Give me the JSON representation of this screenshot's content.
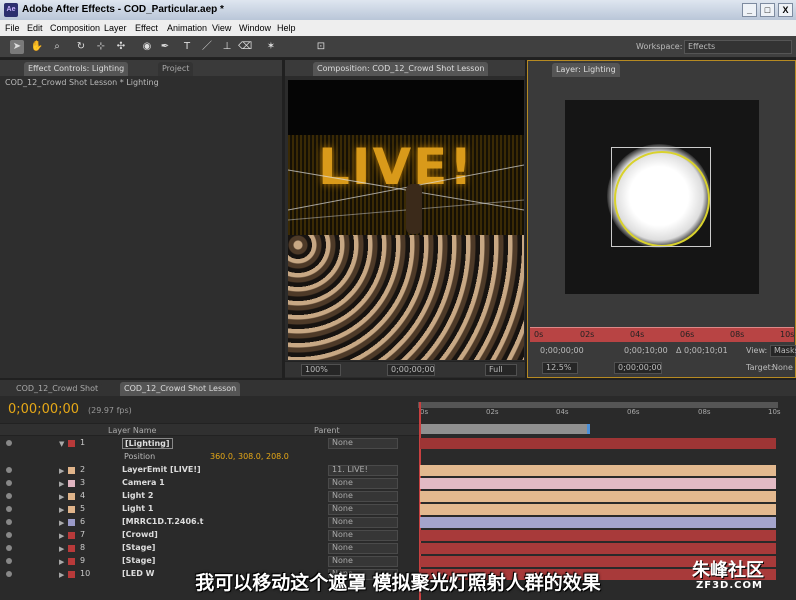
{
  "window": {
    "title": "Adobe After Effects - COD_Particular.aep *",
    "logo": "Ae",
    "min": "_",
    "max": "□",
    "close": "X"
  },
  "menu": [
    "File",
    "Edit",
    "Composition",
    "Layer",
    "Effect",
    "Animation",
    "View",
    "Window",
    "Help"
  ],
  "workspace": {
    "label": "Workspace:",
    "value": "Effects"
  },
  "left_panel": {
    "tabs": [
      "Effect Controls: Lighting",
      "Project"
    ],
    "path": "COD_12_Crowd Shot Lesson * Lighting"
  },
  "comp_panel": {
    "tab": "Composition: COD_12_Crowd Shot Lesson",
    "scene_text": "LIVE!",
    "zoom": "100%",
    "time": "0;00;00;00",
    "resolution": "Full"
  },
  "layer_panel": {
    "tab": "Layer: Lighting",
    "ruler": [
      "0s",
      "02s",
      "04s",
      "06s",
      "08s",
      "10s"
    ],
    "start": "0;00;00;00",
    "end": "0;00;10;00",
    "duration": "Δ 0;00;10;01",
    "view_label": "View:",
    "view_value": "Masks",
    "zoom": "12.5%",
    "time": "0;00;00;00",
    "target_label": "Target:",
    "target_value": "None"
  },
  "timeline": {
    "tabs": [
      "COD_12_Crowd Shot",
      "COD_12_Crowd Shot Lesson"
    ],
    "timecode": "0;00;00;00",
    "fps": "(29.97 fps)",
    "col_layer_name": "Layer Name",
    "col_parent": "Parent",
    "ruler": [
      "0s",
      "02s",
      "04s",
      "06s",
      "08s",
      "10s"
    ],
    "position_label": "Position",
    "position_value": "360.0, 308.0, 208.0",
    "layers": [
      {
        "num": "1",
        "name": "[Lighting]",
        "color": "#b83a3a",
        "parent": "None",
        "bar": "#9e3535"
      },
      {
        "num": "2",
        "name": "LayerEmit [LIVE!]",
        "color": "#e0b48a",
        "parent": "11. LIVE!",
        "bar": "#e3b98f"
      },
      {
        "num": "3",
        "name": "Camera 1",
        "color": "#e0b4c0",
        "parent": "None",
        "bar": "#e2bac4"
      },
      {
        "num": "4",
        "name": "Light 2",
        "color": "#e0b48a",
        "parent": "None",
        "bar": "#e3b98f"
      },
      {
        "num": "5",
        "name": "Light 1",
        "color": "#e0b48a",
        "parent": "None",
        "bar": "#e3b98f"
      },
      {
        "num": "6",
        "name": "[MRRC1D.T.2406.t",
        "color": "#9a9ac8",
        "parent": "None",
        "bar": "#a4a4cc"
      },
      {
        "num": "7",
        "name": "[Crowd]",
        "color": "#b83a3a",
        "parent": "None",
        "bar": "#a83a3a"
      },
      {
        "num": "8",
        "name": "[Stage]",
        "color": "#b83a3a",
        "parent": "None",
        "bar": "#a83a3a"
      },
      {
        "num": "9",
        "name": "[Stage]",
        "color": "#b83a3a",
        "parent": "None",
        "bar": "#a83a3a"
      },
      {
        "num": "10",
        "name": "[LED W",
        "color": "#b83a3a",
        "parent": "None",
        "bar": "#a83a3a"
      }
    ]
  },
  "subtitle": "我可以移动这个遮罩  模拟聚光灯照射人群的效果",
  "watermark": {
    "text": "朱峰社区",
    "url": "ZF3D.COM"
  }
}
